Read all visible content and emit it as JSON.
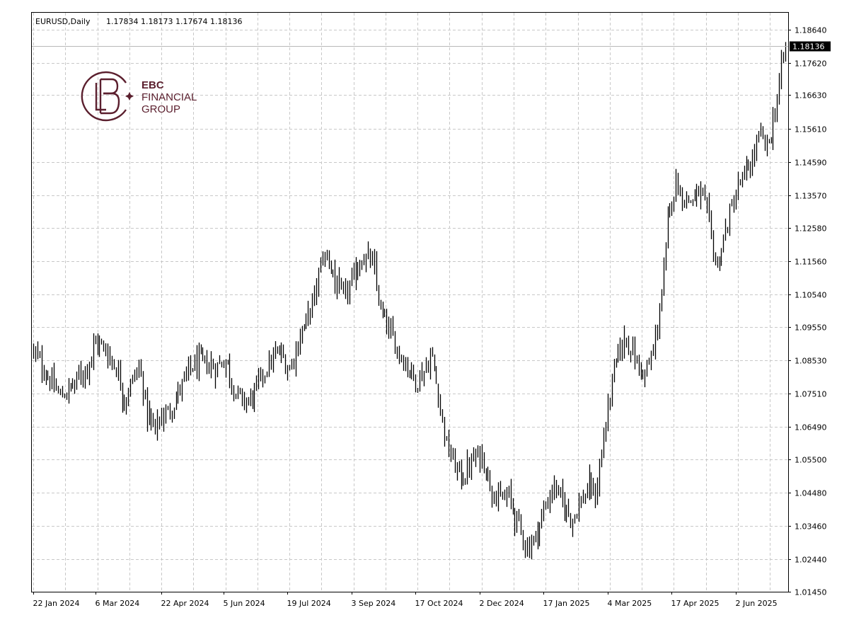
{
  "chart_data": {
    "type": "bar",
    "subtype": "ohlc",
    "title": "EURUSD,Daily",
    "ohlc_header": "1.17834 1.18173 1.17674 1.18136",
    "last_price": "1.18136",
    "last_price_value": 1.18136,
    "ylim": [
      1.0145,
      1.1915
    ],
    "y_ticks": [
      {
        "value": 1.0145,
        "label": "1.01450"
      },
      {
        "value": 1.0244,
        "label": "1.02440"
      },
      {
        "value": 1.0346,
        "label": "1.03460"
      },
      {
        "value": 1.0448,
        "label": "1.04480"
      },
      {
        "value": 1.055,
        "label": "1.05500"
      },
      {
        "value": 1.0649,
        "label": "1.06490"
      },
      {
        "value": 1.0751,
        "label": "1.07510"
      },
      {
        "value": 1.0853,
        "label": "1.08530"
      },
      {
        "value": 1.0955,
        "label": "1.09550"
      },
      {
        "value": 1.1054,
        "label": "1.10540"
      },
      {
        "value": 1.1156,
        "label": "1.11560"
      },
      {
        "value": 1.1258,
        "label": "1.12580"
      },
      {
        "value": 1.1357,
        "label": "1.13570"
      },
      {
        "value": 1.1459,
        "label": "1.14590"
      },
      {
        "value": 1.1561,
        "label": "1.15610"
      },
      {
        "value": 1.1663,
        "label": "1.16630"
      },
      {
        "value": 1.1762,
        "label": "1.17620"
      },
      {
        "value": 1.1864,
        "label": "1.18640"
      }
    ],
    "x_labels": [
      "22 Jan 2024",
      "6 Mar 2024",
      "22 Apr 2024",
      "5 Jun 2024",
      "19 Jul 2024",
      "3 Sep 2024",
      "17 Oct 2024",
      "2 Dec 2024",
      "17 Jan 2025",
      "4 Mar 2025",
      "17 Apr 2025",
      "2 Jun 2025"
    ],
    "x_label_bar_index": [
      0,
      30,
      62,
      92,
      123,
      154,
      185,
      216,
      247,
      278,
      309,
      340
    ],
    "total_bars": 365,
    "grid": true,
    "anchors": [
      [
        0,
        1.088
      ],
      [
        8,
        1.08
      ],
      [
        15,
        1.074
      ],
      [
        22,
        1.078
      ],
      [
        30,
        1.084
      ],
      [
        34,
        1.091
      ],
      [
        40,
        1.088
      ],
      [
        46,
        1.082
      ],
      [
        50,
        1.073
      ],
      [
        55,
        1.08
      ],
      [
        58,
        1.083
      ],
      [
        62,
        1.07
      ],
      [
        66,
        1.064
      ],
      [
        70,
        1.068
      ],
      [
        75,
        1.07
      ],
      [
        80,
        1.076
      ],
      [
        85,
        1.082
      ],
      [
        90,
        1.085
      ],
      [
        95,
        1.084
      ],
      [
        100,
        1.083
      ],
      [
        105,
        1.086
      ],
      [
        110,
        1.076
      ],
      [
        115,
        1.072
      ],
      [
        120,
        1.074
      ],
      [
        125,
        1.08
      ],
      [
        130,
        1.085
      ],
      [
        135,
        1.088
      ],
      [
        140,
        1.082
      ],
      [
        145,
        1.091
      ],
      [
        150,
        1.098
      ],
      [
        155,
        1.107
      ],
      [
        158,
        1.117
      ],
      [
        162,
        1.116
      ],
      [
        166,
        1.108
      ],
      [
        170,
        1.104
      ],
      [
        175,
        1.11
      ],
      [
        180,
        1.117
      ],
      [
        186,
        1.115
      ],
      [
        190,
        1.1
      ],
      [
        195,
        1.094
      ],
      [
        200,
        1.088
      ],
      [
        205,
        1.083
      ],
      [
        210,
        1.079
      ],
      [
        215,
        1.083
      ],
      [
        218,
        1.087
      ],
      [
        222,
        1.074
      ],
      [
        226,
        1.06
      ],
      [
        230,
        1.054
      ],
      [
        235,
        1.049
      ],
      [
        240,
        1.054
      ],
      [
        245,
        1.057
      ],
      [
        250,
        1.048
      ],
      [
        255,
        1.042
      ],
      [
        260,
        1.044
      ],
      [
        265,
        1.036
      ],
      [
        270,
        1.028
      ],
      [
        275,
        1.031
      ],
      [
        280,
        1.04
      ],
      [
        285,
        1.047
      ],
      [
        290,
        1.041
      ],
      [
        295,
        1.037
      ],
      [
        300,
        1.042
      ],
      [
        305,
        1.047
      ],
      [
        308,
        1.043
      ],
      [
        311,
        1.056
      ],
      [
        315,
        1.072
      ],
      [
        320,
        1.087
      ],
      [
        325,
        1.092
      ],
      [
        330,
        1.085
      ],
      [
        335,
        1.08
      ],
      [
        340,
        1.089
      ],
      [
        345,
        1.11
      ],
      [
        348,
        1.13
      ],
      [
        352,
        1.14
      ],
      [
        356,
        1.135
      ],
      [
        360,
        1.134
      ],
      [
        365,
        1.137
      ],
      [
        370,
        1.128
      ],
      [
        374,
        1.113
      ],
      [
        378,
        1.122
      ],
      [
        382,
        1.131
      ],
      [
        386,
        1.138
      ],
      [
        390,
        1.142
      ],
      [
        394,
        1.147
      ],
      [
        398,
        1.154
      ],
      [
        402,
        1.15
      ],
      [
        406,
        1.16
      ],
      [
        409,
        1.172
      ],
      [
        412,
        1.1813
      ]
    ]
  },
  "logo": {
    "line1": "EBC",
    "line2": "FINANCIAL",
    "line3": "GROUP",
    "color": "#5b1f2e"
  }
}
